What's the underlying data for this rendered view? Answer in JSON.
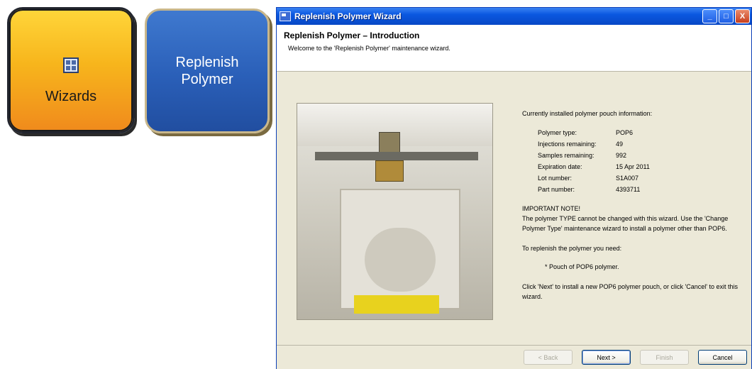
{
  "tiles": {
    "wizards": {
      "label": "Wizards",
      "icon": "wizard-grid-icon",
      "color": "#f7b51c"
    },
    "replenish": {
      "line1": "Replenish",
      "line2": "Polymer",
      "color": "#2a5fb8"
    }
  },
  "window": {
    "title": "Replenish Polymer Wizard",
    "controls": {
      "minimize": "_",
      "maximize": "□",
      "close": "X"
    }
  },
  "header": {
    "title": "Replenish Polymer – Introduction",
    "subtitle": "Welcome to the 'Replenish Polymer' maintenance wizard."
  },
  "info": {
    "intro": "Currently installed polymer pouch information:",
    "rows": [
      {
        "key": "Polymer type:",
        "value": "POP6"
      },
      {
        "key": "Injections remaining:",
        "value": "49"
      },
      {
        "key": "Samples remaining:",
        "value": "992"
      },
      {
        "key": "Expiration date:",
        "value": "15 Apr 2011"
      },
      {
        "key": "Lot number:",
        "value": "S1A007"
      },
      {
        "key": "Part number:",
        "value": "4393711"
      }
    ],
    "note_title": "IMPORTANT NOTE!",
    "note_body": "The polymer TYPE cannot be changed with this wizard. Use the 'Change Polymer Type' maintenance wizard to install a polymer other than POP6.",
    "need": "To replenish the polymer you need:",
    "bullet": "* Pouch of POP6 polymer.",
    "instructions": "Click 'Next' to install a new POP6 polymer pouch, or click 'Cancel' to exit this wizard."
  },
  "buttons": {
    "back": "< Back",
    "next": "Next >",
    "finish": "Finish",
    "cancel": "Cancel"
  }
}
